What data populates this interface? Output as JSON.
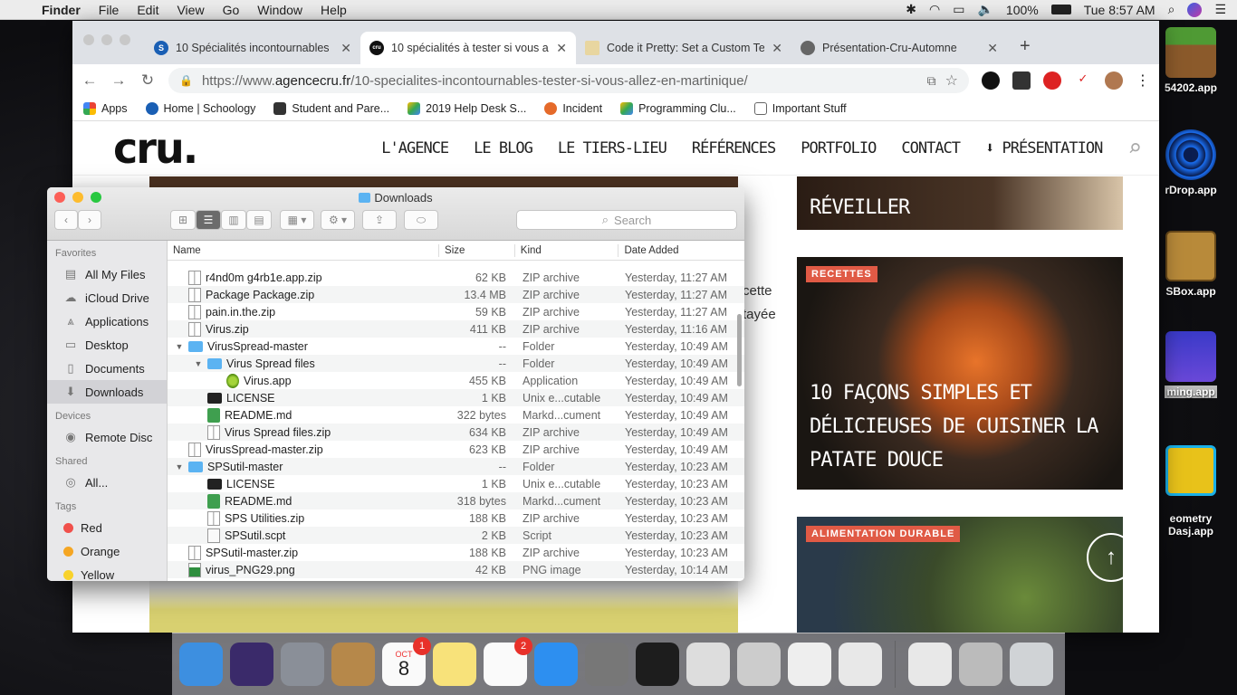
{
  "menubar": {
    "app": "Finder",
    "items": [
      "File",
      "Edit",
      "View",
      "Go",
      "Window",
      "Help"
    ],
    "battery": "100%",
    "clock": "Tue 8:57 AM"
  },
  "desktop_icons": [
    {
      "label": "54202.app"
    },
    {
      "label": "rDrop.app"
    },
    {
      "label": "SBox.app"
    },
    {
      "label": "ming.app"
    },
    {
      "label": "eometry\nDasj.app"
    }
  ],
  "chrome": {
    "tabs": [
      {
        "title": "10 Spécialités incontournables",
        "fav": "S"
      },
      {
        "title": "10 spécialités à tester si vous a",
        "fav": "cru"
      },
      {
        "title": "Code it Pretty: Set a Custom Te",
        "fav": ""
      },
      {
        "title": "Présentation-Cru-Automne",
        "fav": ""
      }
    ],
    "url_prefix": "https://www.",
    "url_host": "agencecru.fr",
    "url_path": "/10-specialites-incontournables-tester-si-vous-allez-en-martinique/",
    "bookmarks": [
      "Apps",
      "Home | Schoology",
      "Student and Pare...",
      "2019 Help Desk S...",
      "Incident",
      "Programming Clu...",
      "Important Stuff"
    ]
  },
  "site": {
    "logo": "cru.",
    "nav": [
      "L'AGENCE",
      "LE BLOG",
      "LE TIERS-LIEU",
      "RÉFÉRENCES",
      "PORTFOLIO",
      "CONTACT",
      "PRÉSENTATION"
    ],
    "card1_title": "RÉVEILLER",
    "card2_badge": "RECETTES",
    "card2_title": "10 FAÇONS SIMPLES ET DÉLICIEUSES DE CUISINER LA PATATE DOUCE",
    "card3_badge": "ALIMENTATION DURABLE",
    "text_line1": "cette",
    "text_line2": "tayée"
  },
  "finder": {
    "title": "Downloads",
    "search_placeholder": "Search",
    "sidebar": {
      "favorites_head": "Favorites",
      "favorites": [
        "All My Files",
        "iCloud Drive",
        "Applications",
        "Desktop",
        "Documents",
        "Downloads"
      ],
      "devices_head": "Devices",
      "devices": [
        "Remote Disc"
      ],
      "shared_head": "Shared",
      "shared": [
        "All..."
      ],
      "tags_head": "Tags",
      "tags": [
        {
          "name": "Red",
          "color": "#f0504b"
        },
        {
          "name": "Orange",
          "color": "#f5a623"
        },
        {
          "name": "Yellow",
          "color": "#f8d22b"
        }
      ]
    },
    "columns": [
      "Name",
      "Size",
      "Kind",
      "Date Added"
    ],
    "rows": [
      {
        "indent": 0,
        "disc": "",
        "icon": "zip",
        "name": "r4nd0m g4rb1e.app.zip",
        "size": "62 KB",
        "kind": "ZIP archive",
        "date": "Yesterday, 11:27 AM"
      },
      {
        "indent": 0,
        "disc": "",
        "icon": "zip",
        "name": "Package Package.zip",
        "size": "13.4 MB",
        "kind": "ZIP archive",
        "date": "Yesterday, 11:27 AM"
      },
      {
        "indent": 0,
        "disc": "",
        "icon": "zip",
        "name": "pain.in.the.zip",
        "size": "59 KB",
        "kind": "ZIP archive",
        "date": "Yesterday, 11:27 AM"
      },
      {
        "indent": 0,
        "disc": "",
        "icon": "zip",
        "name": "Virus.zip",
        "size": "411 KB",
        "kind": "ZIP archive",
        "date": "Yesterday, 11:16 AM"
      },
      {
        "indent": 0,
        "disc": "▼",
        "icon": "folder",
        "name": "VirusSpread-master",
        "size": "--",
        "kind": "Folder",
        "date": "Yesterday, 10:49 AM"
      },
      {
        "indent": 1,
        "disc": "▼",
        "icon": "folder",
        "name": "Virus Spread files",
        "size": "--",
        "kind": "Folder",
        "date": "Yesterday, 10:49 AM"
      },
      {
        "indent": 2,
        "disc": "",
        "icon": "app",
        "name": "Virus.app",
        "size": "455 KB",
        "kind": "Application",
        "date": "Yesterday, 10:49 AM"
      },
      {
        "indent": 1,
        "disc": "",
        "icon": "unix",
        "name": "LICENSE",
        "size": "1 KB",
        "kind": "Unix e...cutable",
        "date": "Yesterday, 10:49 AM"
      },
      {
        "indent": 1,
        "disc": "",
        "icon": "md",
        "name": "README.md",
        "size": "322 bytes",
        "kind": "Markd...cument",
        "date": "Yesterday, 10:49 AM"
      },
      {
        "indent": 1,
        "disc": "",
        "icon": "zip",
        "name": "Virus Spread files.zip",
        "size": "634 KB",
        "kind": "ZIP archive",
        "date": "Yesterday, 10:49 AM"
      },
      {
        "indent": 0,
        "disc": "",
        "icon": "zip",
        "name": "VirusSpread-master.zip",
        "size": "623 KB",
        "kind": "ZIP archive",
        "date": "Yesterday, 10:49 AM"
      },
      {
        "indent": 0,
        "disc": "▼",
        "icon": "folder",
        "name": "SPSutil-master",
        "size": "--",
        "kind": "Folder",
        "date": "Yesterday, 10:23 AM"
      },
      {
        "indent": 1,
        "disc": "",
        "icon": "unix",
        "name": "LICENSE",
        "size": "1 KB",
        "kind": "Unix e...cutable",
        "date": "Yesterday, 10:23 AM"
      },
      {
        "indent": 1,
        "disc": "",
        "icon": "md",
        "name": "README.md",
        "size": "318 bytes",
        "kind": "Markd...cument",
        "date": "Yesterday, 10:23 AM"
      },
      {
        "indent": 1,
        "disc": "",
        "icon": "zip",
        "name": "SPS Utilities.zip",
        "size": "188 KB",
        "kind": "ZIP archive",
        "date": "Yesterday, 10:23 AM"
      },
      {
        "indent": 1,
        "disc": "",
        "icon": "script",
        "name": "SPSutil.scpt",
        "size": "2 KB",
        "kind": "Script",
        "date": "Yesterday, 10:23 AM"
      },
      {
        "indent": 0,
        "disc": "",
        "icon": "zip",
        "name": "SPSutil-master.zip",
        "size": "188 KB",
        "kind": "ZIP archive",
        "date": "Yesterday, 10:23 AM"
      },
      {
        "indent": 0,
        "disc": "",
        "icon": "png",
        "name": "virus_PNG29.png",
        "size": "42 KB",
        "kind": "PNG image",
        "date": "Yesterday, 10:14 AM"
      }
    ]
  },
  "dock": {
    "apps": [
      {
        "name": "finder-icon",
        "color": "#3d8fe0"
      },
      {
        "name": "siri-icon",
        "color": "#3a2a6a"
      },
      {
        "name": "launchpad-icon",
        "color": "#8a8f98"
      },
      {
        "name": "contacts-icon",
        "color": "#b6884a"
      },
      {
        "name": "calendar-icon",
        "color": "#fafafa",
        "badge": "1",
        "month": "OCT",
        "day": "8"
      },
      {
        "name": "notes-icon",
        "color": "#f8e27a"
      },
      {
        "name": "reminders-icon",
        "color": "#fafafa",
        "badge": "2"
      },
      {
        "name": "app-store-icon",
        "color": "#2d8ff0"
      },
      {
        "name": "system-preferences-icon",
        "color": "#777"
      },
      {
        "name": "terminal-icon",
        "color": "#1d1d1d"
      },
      {
        "name": "script-editor-icon",
        "color": "#ddd"
      },
      {
        "name": "instruments-icon",
        "color": "#ccc"
      },
      {
        "name": "textedit-icon",
        "color": "#eee"
      },
      {
        "name": "chrome-icon",
        "color": "#e8e8e8"
      }
    ],
    "right": [
      {
        "name": "zip-file-icon",
        "color": "#e8e8e8"
      },
      {
        "name": "unknown-volume-icon",
        "color": "#bbb"
      },
      {
        "name": "trash-icon",
        "color": "#d0d3d6"
      }
    ]
  }
}
